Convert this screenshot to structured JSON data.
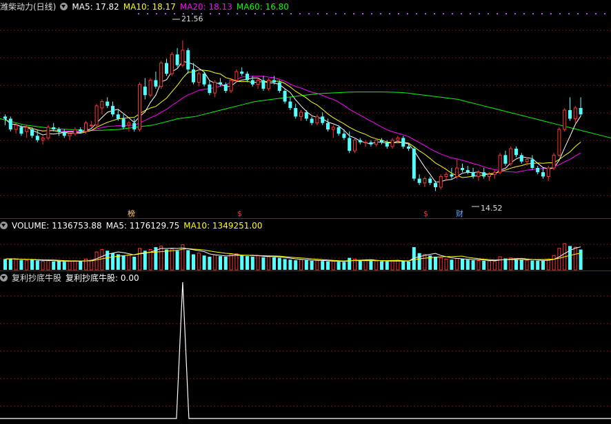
{
  "main": {
    "title": "潍柴动力(日线)",
    "ma5_label": "MA5: 17.82",
    "ma10_label": "MA10: 18.17",
    "ma20_label": "MA20: 18.13",
    "ma60_label": "MA60: 16.80",
    "high_label": "21.56",
    "low_label": "14.52",
    "markers": [
      "榜",
      "$",
      "$",
      "财"
    ]
  },
  "volume": {
    "label": "VOLUME: 1136753.88",
    "ma5_label": "MA5: 1176129.75",
    "ma10_label": "MA10: 1349251.00"
  },
  "indicator": {
    "label": "复利抄底牛股",
    "value_label": "复利抄底牛股: 0.00"
  },
  "colors": {
    "up": "#ff3232",
    "down": "#54ffff",
    "ma5": "#ffffff",
    "ma10": "#ffff00",
    "ma20": "#ff00ff",
    "ma60": "#00ff00",
    "grid": "#7a1010",
    "dots": "#cc44ff"
  },
  "chart_data": {
    "type": "candlestick",
    "price_ylim": [
      13.8,
      22.8
    ],
    "candles": [
      {
        "o": 18.0,
        "h": 18.1,
        "l": 17.6,
        "c": 17.9
      },
      {
        "o": 17.9,
        "h": 18.0,
        "l": 17.3,
        "c": 17.4
      },
      {
        "o": 17.4,
        "h": 17.7,
        "l": 17.2,
        "c": 17.6
      },
      {
        "o": 17.5,
        "h": 17.6,
        "l": 17.1,
        "c": 17.2
      },
      {
        "o": 17.3,
        "h": 17.6,
        "l": 17.0,
        "c": 17.5
      },
      {
        "o": 17.4,
        "h": 17.5,
        "l": 17.0,
        "c": 17.1
      },
      {
        "o": 17.1,
        "h": 17.4,
        "l": 16.8,
        "c": 16.9
      },
      {
        "o": 16.9,
        "h": 17.1,
        "l": 16.7,
        "c": 17.0
      },
      {
        "o": 17.0,
        "h": 17.6,
        "l": 16.9,
        "c": 17.5
      },
      {
        "o": 17.5,
        "h": 17.7,
        "l": 17.3,
        "c": 17.4
      },
      {
        "o": 17.4,
        "h": 17.5,
        "l": 17.1,
        "c": 17.3
      },
      {
        "o": 17.3,
        "h": 17.4,
        "l": 17.0,
        "c": 17.1
      },
      {
        "o": 17.1,
        "h": 17.3,
        "l": 16.9,
        "c": 17.2
      },
      {
        "o": 17.2,
        "h": 17.5,
        "l": 17.1,
        "c": 17.4
      },
      {
        "o": 17.4,
        "h": 17.5,
        "l": 17.2,
        "c": 17.3
      },
      {
        "o": 17.3,
        "h": 17.8,
        "l": 17.2,
        "c": 17.7
      },
      {
        "o": 17.6,
        "h": 17.8,
        "l": 17.5,
        "c": 17.6
      },
      {
        "o": 17.6,
        "h": 18.6,
        "l": 17.5,
        "c": 18.5
      },
      {
        "o": 18.4,
        "h": 18.8,
        "l": 18.1,
        "c": 18.7
      },
      {
        "o": 18.7,
        "h": 18.9,
        "l": 18.4,
        "c": 18.5
      },
      {
        "o": 18.5,
        "h": 18.7,
        "l": 18.0,
        "c": 18.1
      },
      {
        "o": 18.1,
        "h": 18.3,
        "l": 17.8,
        "c": 17.9
      },
      {
        "o": 17.9,
        "h": 18.1,
        "l": 17.4,
        "c": 17.5
      },
      {
        "o": 17.6,
        "h": 17.8,
        "l": 17.3,
        "c": 17.7
      },
      {
        "o": 17.7,
        "h": 17.9,
        "l": 17.3,
        "c": 17.4
      },
      {
        "o": 17.4,
        "h": 19.6,
        "l": 17.3,
        "c": 19.5
      },
      {
        "o": 19.4,
        "h": 19.8,
        "l": 18.8,
        "c": 19.0
      },
      {
        "o": 19.0,
        "h": 19.8,
        "l": 18.9,
        "c": 19.7
      },
      {
        "o": 19.7,
        "h": 20.1,
        "l": 19.3,
        "c": 19.4
      },
      {
        "o": 19.4,
        "h": 20.6,
        "l": 19.3,
        "c": 20.5
      },
      {
        "o": 20.5,
        "h": 20.7,
        "l": 19.9,
        "c": 20.0
      },
      {
        "o": 20.0,
        "h": 21.0,
        "l": 19.9,
        "c": 20.9
      },
      {
        "o": 20.9,
        "h": 21.2,
        "l": 20.3,
        "c": 20.4
      },
      {
        "o": 20.4,
        "h": 21.56,
        "l": 20.3,
        "c": 21.1
      },
      {
        "o": 21.1,
        "h": 21.2,
        "l": 20.0,
        "c": 20.2
      },
      {
        "o": 20.2,
        "h": 20.5,
        "l": 19.5,
        "c": 19.6
      },
      {
        "o": 19.6,
        "h": 20.1,
        "l": 19.4,
        "c": 20.0
      },
      {
        "o": 20.0,
        "h": 20.1,
        "l": 19.4,
        "c": 19.5
      },
      {
        "o": 19.5,
        "h": 19.7,
        "l": 19.0,
        "c": 19.1
      },
      {
        "o": 19.1,
        "h": 19.7,
        "l": 18.9,
        "c": 19.6
      },
      {
        "o": 19.6,
        "h": 19.8,
        "l": 19.4,
        "c": 19.5
      },
      {
        "o": 19.5,
        "h": 19.6,
        "l": 19.1,
        "c": 19.2
      },
      {
        "o": 19.2,
        "h": 19.8,
        "l": 19.1,
        "c": 19.7
      },
      {
        "o": 19.7,
        "h": 20.2,
        "l": 19.6,
        "c": 20.1
      },
      {
        "o": 20.1,
        "h": 20.3,
        "l": 19.9,
        "c": 20.0
      },
      {
        "o": 20.0,
        "h": 20.1,
        "l": 19.6,
        "c": 19.7
      },
      {
        "o": 19.7,
        "h": 19.9,
        "l": 19.4,
        "c": 19.5
      },
      {
        "o": 19.5,
        "h": 19.8,
        "l": 19.3,
        "c": 19.7
      },
      {
        "o": 19.7,
        "h": 19.9,
        "l": 19.2,
        "c": 19.3
      },
      {
        "o": 19.3,
        "h": 19.8,
        "l": 19.2,
        "c": 19.7
      },
      {
        "o": 19.7,
        "h": 19.9,
        "l": 19.5,
        "c": 19.6
      },
      {
        "o": 19.6,
        "h": 19.7,
        "l": 19.1,
        "c": 19.2
      },
      {
        "o": 19.2,
        "h": 19.3,
        "l": 18.6,
        "c": 18.7
      },
      {
        "o": 18.7,
        "h": 18.9,
        "l": 18.3,
        "c": 18.4
      },
      {
        "o": 18.4,
        "h": 18.6,
        "l": 17.9,
        "c": 18.0
      },
      {
        "o": 18.0,
        "h": 18.3,
        "l": 17.8,
        "c": 18.2
      },
      {
        "o": 18.2,
        "h": 18.3,
        "l": 17.8,
        "c": 17.9
      },
      {
        "o": 17.9,
        "h": 18.0,
        "l": 17.6,
        "c": 17.7
      },
      {
        "o": 17.7,
        "h": 18.1,
        "l": 17.6,
        "c": 18.0
      },
      {
        "o": 18.0,
        "h": 18.2,
        "l": 17.6,
        "c": 17.7
      },
      {
        "o": 17.7,
        "h": 17.9,
        "l": 17.3,
        "c": 17.4
      },
      {
        "o": 17.4,
        "h": 17.6,
        "l": 17.0,
        "c": 17.5
      },
      {
        "o": 17.5,
        "h": 17.6,
        "l": 17.1,
        "c": 17.2
      },
      {
        "o": 17.2,
        "h": 17.4,
        "l": 16.9,
        "c": 17.0
      },
      {
        "o": 17.0,
        "h": 17.3,
        "l": 16.3,
        "c": 16.4
      },
      {
        "o": 16.4,
        "h": 17.0,
        "l": 16.3,
        "c": 16.9
      },
      {
        "o": 16.9,
        "h": 17.0,
        "l": 16.7,
        "c": 16.8
      },
      {
        "o": 16.8,
        "h": 16.9,
        "l": 16.6,
        "c": 16.8
      },
      {
        "o": 16.8,
        "h": 16.9,
        "l": 16.6,
        "c": 16.7
      },
      {
        "o": 16.7,
        "h": 17.0,
        "l": 16.6,
        "c": 16.9
      },
      {
        "o": 16.9,
        "h": 17.0,
        "l": 16.7,
        "c": 16.8
      },
      {
        "o": 16.8,
        "h": 16.9,
        "l": 16.5,
        "c": 16.6
      },
      {
        "o": 16.6,
        "h": 17.0,
        "l": 16.5,
        "c": 16.9
      },
      {
        "o": 16.9,
        "h": 17.1,
        "l": 16.8,
        "c": 17.0
      },
      {
        "o": 17.0,
        "h": 17.1,
        "l": 16.5,
        "c": 16.6
      },
      {
        "o": 16.6,
        "h": 16.7,
        "l": 16.4,
        "c": 16.5
      },
      {
        "o": 16.5,
        "h": 16.6,
        "l": 15.0,
        "c": 15.1
      },
      {
        "o": 15.1,
        "h": 15.3,
        "l": 14.8,
        "c": 14.9
      },
      {
        "o": 14.9,
        "h": 15.2,
        "l": 14.7,
        "c": 15.1
      },
      {
        "o": 15.1,
        "h": 15.2,
        "l": 14.8,
        "c": 14.9
      },
      {
        "o": 14.9,
        "h": 15.0,
        "l": 14.52,
        "c": 14.7
      },
      {
        "o": 14.7,
        "h": 15.3,
        "l": 14.6,
        "c": 15.2
      },
      {
        "o": 15.2,
        "h": 15.4,
        "l": 15.0,
        "c": 15.3
      },
      {
        "o": 15.3,
        "h": 15.6,
        "l": 15.1,
        "c": 15.2
      },
      {
        "o": 15.2,
        "h": 16.0,
        "l": 15.1,
        "c": 15.6
      },
      {
        "o": 15.6,
        "h": 15.8,
        "l": 15.4,
        "c": 15.5
      },
      {
        "o": 15.5,
        "h": 15.7,
        "l": 15.3,
        "c": 15.4
      },
      {
        "o": 15.4,
        "h": 15.6,
        "l": 15.1,
        "c": 15.2
      },
      {
        "o": 15.2,
        "h": 15.5,
        "l": 15.0,
        "c": 15.4
      },
      {
        "o": 15.4,
        "h": 15.6,
        "l": 15.1,
        "c": 15.2
      },
      {
        "o": 15.2,
        "h": 15.4,
        "l": 15.0,
        "c": 15.3
      },
      {
        "o": 15.3,
        "h": 15.5,
        "l": 15.1,
        "c": 15.4
      },
      {
        "o": 15.4,
        "h": 16.3,
        "l": 15.3,
        "c": 16.2
      },
      {
        "o": 16.2,
        "h": 16.4,
        "l": 15.7,
        "c": 15.8
      },
      {
        "o": 15.8,
        "h": 16.6,
        "l": 15.7,
        "c": 16.5
      },
      {
        "o": 16.5,
        "h": 16.6,
        "l": 16.1,
        "c": 16.2
      },
      {
        "o": 16.2,
        "h": 16.3,
        "l": 15.8,
        "c": 15.9
      },
      {
        "o": 15.9,
        "h": 16.1,
        "l": 15.7,
        "c": 16.0
      },
      {
        "o": 16.0,
        "h": 16.2,
        "l": 15.5,
        "c": 15.6
      },
      {
        "o": 15.6,
        "h": 15.7,
        "l": 15.3,
        "c": 15.4
      },
      {
        "o": 15.4,
        "h": 15.6,
        "l": 15.1,
        "c": 15.2
      },
      {
        "o": 15.2,
        "h": 15.7,
        "l": 15.0,
        "c": 15.6
      },
      {
        "o": 15.6,
        "h": 16.3,
        "l": 15.5,
        "c": 16.2
      },
      {
        "o": 16.2,
        "h": 17.5,
        "l": 16.1,
        "c": 17.4
      },
      {
        "o": 17.4,
        "h": 18.4,
        "l": 17.3,
        "c": 18.3
      },
      {
        "o": 18.3,
        "h": 18.9,
        "l": 17.8,
        "c": 17.9
      },
      {
        "o": 17.9,
        "h": 18.5,
        "l": 17.7,
        "c": 18.4
      },
      {
        "o": 18.4,
        "h": 18.9,
        "l": 18.0,
        "c": 18.1
      }
    ],
    "ma60": [
      17.9,
      17.8,
      17.7,
      17.6,
      17.55,
      17.5,
      17.45,
      17.42,
      17.4,
      17.38,
      17.36,
      17.35,
      17.36,
      17.38,
      17.4,
      17.45,
      17.5,
      17.55,
      17.6,
      17.7,
      17.8,
      17.9,
      17.95,
      18.0,
      18.1,
      18.2,
      18.3,
      18.4,
      18.5,
      18.6,
      18.7,
      18.75,
      18.8,
      18.85,
      18.9,
      18.95,
      19.0,
      19.05,
      19.08,
      19.1,
      19.12,
      19.14,
      19.15,
      19.15,
      19.15,
      19.15,
      19.14,
      19.13,
      19.1,
      19.05,
      19.0,
      18.95,
      18.9,
      18.85,
      18.8,
      18.7,
      18.6,
      18.5,
      18.4,
      18.3,
      18.2,
      18.1,
      18.0,
      17.9,
      17.8,
      17.7,
      17.6,
      17.5,
      17.4,
      17.3,
      17.2,
      17.1,
      17.0
    ],
    "volume_ylim": [
      0,
      3000000
    ],
    "volumes": [
      900000,
      950000,
      880000,
      820000,
      800000,
      860000,
      780000,
      720000,
      760000,
      700000,
      740000,
      680000,
      720000,
      760000,
      700000,
      900000,
      820000,
      1500000,
      1700000,
      1600000,
      1400000,
      1300000,
      1200000,
      1250000,
      1100000,
      1800000,
      1600000,
      1700000,
      1900000,
      2000000,
      1700000,
      1750000,
      1600000,
      2100000,
      1650000,
      1300000,
      1400000,
      1200000,
      1100000,
      1250000,
      1150000,
      1100000,
      1300000,
      1350000,
      1200000,
      1150000,
      1100000,
      1200000,
      1050000,
      1100000,
      1050000,
      1000000,
      900000,
      850000,
      800000,
      850000,
      800000,
      750000,
      780000,
      740000,
      700000,
      720000,
      680000,
      650000,
      1000000,
      900000,
      820000,
      780000,
      760000,
      740000,
      720000,
      700000,
      760000,
      800000,
      720000,
      700000,
      1900000,
      1400000,
      1300000,
      1200000,
      1100000,
      1000000,
      900000,
      850000,
      950000,
      900000,
      850000,
      800000,
      780000,
      760000,
      740000,
      720000,
      1100000,
      950000,
      1000000,
      900000,
      850000,
      800000,
      780000,
      760000,
      750000,
      900000,
      1200000,
      1800000,
      2200000,
      2000000,
      1900000,
      1700000
    ],
    "indicator_ylim": [
      0,
      1
    ],
    "indicator_peak_index": 33,
    "indicator_peak_value": 1
  }
}
